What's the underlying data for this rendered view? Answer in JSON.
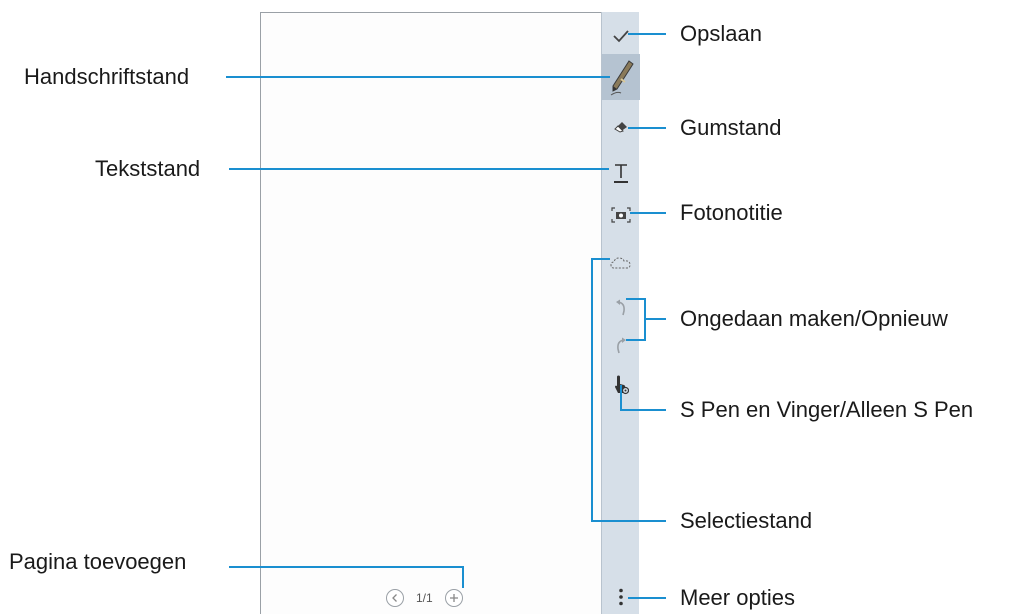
{
  "note": {
    "page_indicator": "1/1"
  },
  "toolbar": {
    "tools": [
      {
        "name": "check-icon"
      },
      {
        "name": "pen-icon"
      },
      {
        "name": "eraser-icon"
      },
      {
        "name": "text-icon"
      },
      {
        "name": "camera-icon"
      },
      {
        "name": "lasso-icon"
      },
      {
        "name": "undo-icon"
      },
      {
        "name": "redo-icon"
      },
      {
        "name": "finger-spen-icon"
      },
      {
        "name": "more-icon"
      }
    ]
  },
  "labels": {
    "save": "Opslaan",
    "handwriting": "Handschriftstand",
    "eraser": "Gumstand",
    "text": "Tekststand",
    "photo_note": "Fotonotitie",
    "undo_redo": "Ongedaan maken/Opnieuw",
    "spen_finger": "S Pen en Vinger/Alleen S Pen",
    "selection": "Selectiestand",
    "add_page": "Pagina toevoegen",
    "more_options": "Meer opties"
  },
  "colors": {
    "callout_line": "#1a8fd0",
    "toolbar_bg": "#d6dfe8",
    "active_tool_bg": "#b5c3d1"
  }
}
